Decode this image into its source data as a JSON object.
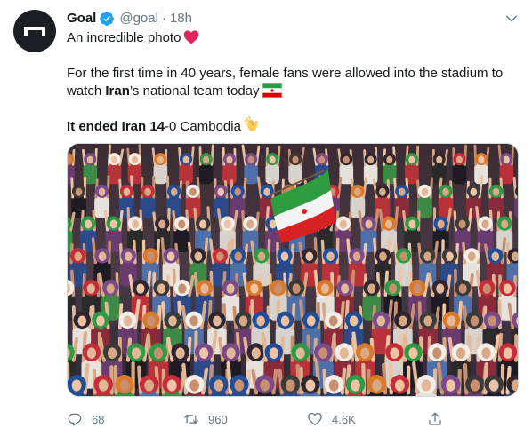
{
  "tweet": {
    "author_name": "Goal",
    "handle": "@goal",
    "separator": "·",
    "time": "18h",
    "line1": "An incredible photo",
    "line2": "For the first time in 40 years, female fans were allowed into the stadium to",
    "line3_pre": "watch ",
    "line3_bold": "Iran",
    "line3_post": "’s national team today",
    "line4_bold1": "It ended Iran 14",
    "line4_plain": "-0 Cambodia",
    "photo_alt": "Female fans cheering in the stadium holding an Iranian flag"
  },
  "actions": {
    "reply_count": "68",
    "retweet_count": "960",
    "like_count": "4.6K"
  },
  "icons": {
    "avatar": "goal-logo-icon",
    "verified": "verified-badge-icon",
    "caret": "chevron-down-icon",
    "heart": "red-heart-emoji",
    "flag": "iran-flag-emoji",
    "clap": "clapping-hands-emoji",
    "reply": "reply-icon",
    "retweet": "retweet-icon",
    "like": "heart-outline-icon",
    "share": "share-icon"
  },
  "colors": {
    "text": "#14171a",
    "secondary": "#657786",
    "verified": "#1da1f2",
    "heart": "#e0245e",
    "flag_green": "#239f40",
    "flag_red": "#da0000"
  }
}
